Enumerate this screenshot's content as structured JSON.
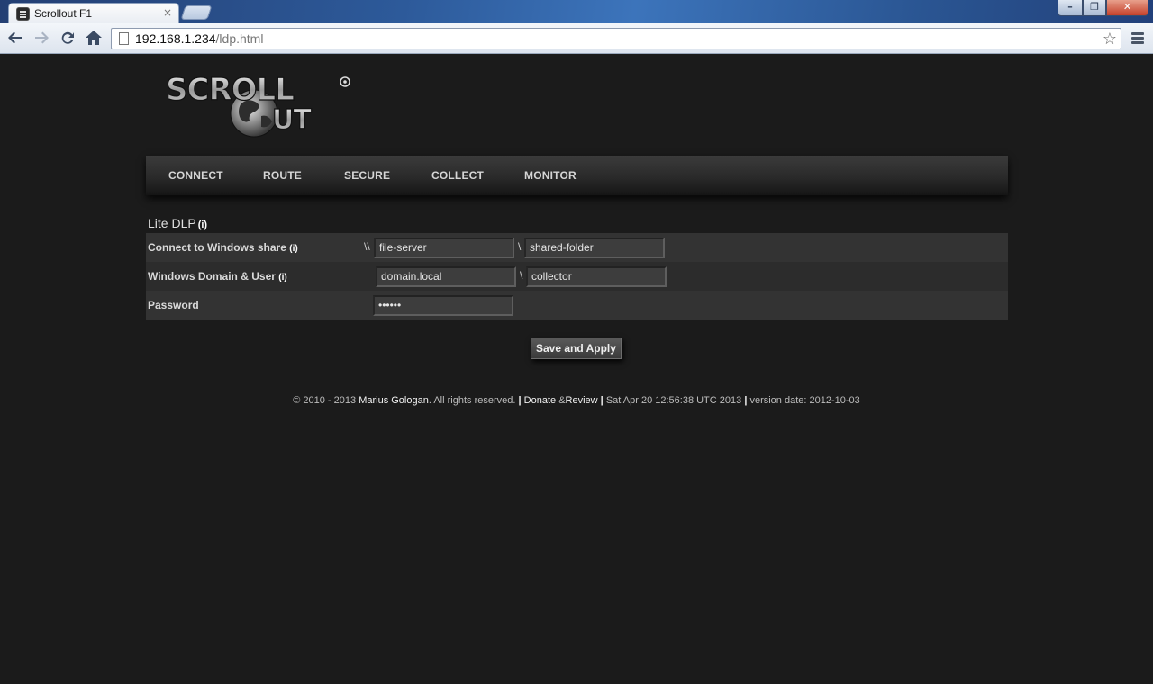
{
  "browser": {
    "tab_title": "Scrollout F1",
    "tab_close": "×",
    "url_host": "192.168.1.234",
    "url_path": "/ldp.html"
  },
  "nav": {
    "items": [
      "CONNECT",
      "ROUTE",
      "SECURE",
      "COLLECT",
      "MONITOR"
    ]
  },
  "section": {
    "title": "Lite DLP",
    "info": "(i)"
  },
  "form": {
    "share": {
      "label": "Connect to Windows share",
      "info": "(i)",
      "prefix": "\\\\",
      "server": "file-server",
      "sep": "\\",
      "folder": "shared-folder"
    },
    "domain": {
      "label": "Windows Domain & User",
      "info": "(i)",
      "domain": "domain.local",
      "sep": "\\",
      "user": "collector"
    },
    "password": {
      "label": "Password",
      "value": "••••••"
    },
    "save_label": "Save and Apply"
  },
  "footer": {
    "copyright": "© 2010 - 2013",
    "author": "Marius Gologan",
    "rights": ". All rights reserved.",
    "donate": "Donate",
    "amp": "&",
    "review": "Review",
    "date": "Sat Apr 20 12:56:38 UTC 2013",
    "version": "version date: 2012-10-03"
  },
  "colors": {
    "background": "#1b1b1b",
    "row_light": "#333333",
    "row_dark": "#2c2c2c"
  }
}
